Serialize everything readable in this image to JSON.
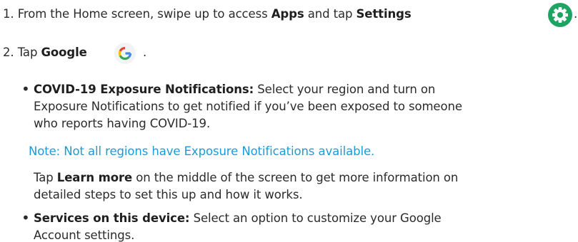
{
  "step1": {
    "prefix": "1. From the Home screen, swipe up to access ",
    "apps": "Apps",
    "middle": " and tap ",
    "settings": "Settings",
    "suffix": "."
  },
  "step2": {
    "prefix": "2. Tap ",
    "google": "Google",
    "suffix": "."
  },
  "bullet1": {
    "title": "COVID-19 Exposure Notifications:",
    "line1": " Select your region and turn on",
    "line2": "Exposure Notifications to get notified if you’ve been exposed to someone",
    "line3": "who reports having COVID-19."
  },
  "note": "Note: Not all regions have Exposure Notifications available.",
  "learn": {
    "prefix": "Tap ",
    "bold": "Learn more",
    "line1_rest": " on the middle of the screen to get more information on",
    "line2": "detailed steps to set this up and how it works."
  },
  "bullet2": {
    "title": "Services on this device:",
    "line1": " Select an option to customize your Google",
    "line2": "Account settings."
  },
  "icons": {
    "settings": "settings-gear-icon",
    "google": "google-g-icon",
    "bullet": "•",
    "settings_color": "#1ea362",
    "google_colors": [
      "#4285F4",
      "#34A853",
      "#FBBC05",
      "#EA4335"
    ]
  }
}
